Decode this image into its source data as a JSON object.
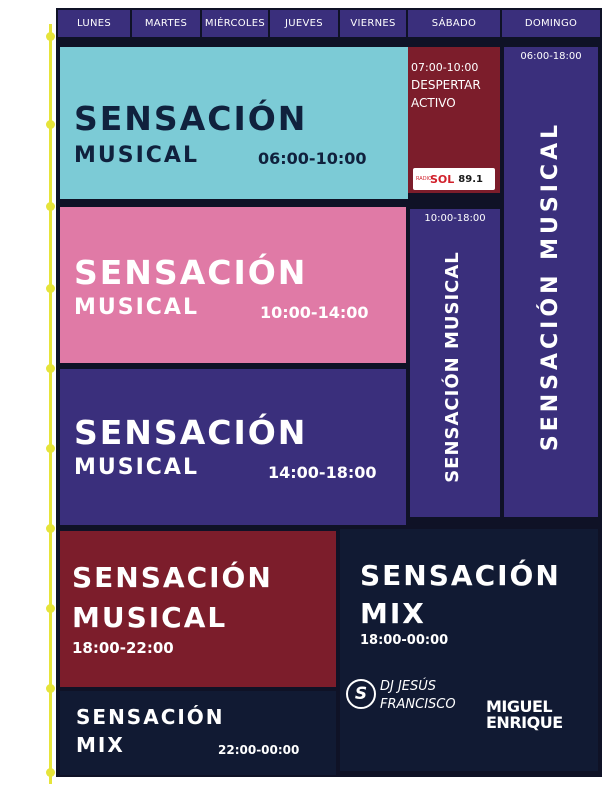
{
  "days": [
    "LUNES",
    "MARTES",
    "MIÉRCOLES",
    "JUEVES",
    "VIERNES",
    "SÁBADO",
    "DOMINGO"
  ],
  "blocks": {
    "b1": {
      "title1": "SENSACIÓN",
      "title2": "MUSICAL",
      "time": "06:00-10:00",
      "color": "#7ccbd6"
    },
    "b2": {
      "title1": "SENSACIÓN",
      "title2": "MUSICAL",
      "time": "10:00-14:00",
      "color": "#e07aa6"
    },
    "b3": {
      "title1": "SENSACIÓN",
      "title2": "MUSICAL",
      "time": "14:00-18:00",
      "color": "#3a2f7c"
    },
    "b4": {
      "title1": "SENSACIÓN",
      "title2": "MUSICAL",
      "time": "18:00-22:00",
      "color": "#7c1d2b"
    },
    "b5": {
      "title1": "SENSACIÓN",
      "title2": "MIX",
      "time": "22:00-00:00",
      "color": "#111a33"
    },
    "b6": {
      "title1": "SENSACIÓN",
      "title2": "MIX",
      "time": "18:00-00:00",
      "color": "#111a33"
    },
    "despertar": {
      "time": "07:00-10:00",
      "line1": "DESPERTAR",
      "line2": "ACTIVO",
      "color": "#7c1d2b"
    },
    "sat": {
      "time": "10:00-18:00",
      "label": "SENSACIÓN MUSICAL",
      "color": "#3a2f7c"
    },
    "sun": {
      "time": "06:00-18:00",
      "label": "SENSACIÓN MUSICAL",
      "color": "#3a2f7c"
    }
  },
  "logos": {
    "radio_small": "RADIO",
    "radio_name": "SOL",
    "radio_freq": "89.1",
    "dj_line1": "DJ JESÚS",
    "dj_line2": "FRANCISCO",
    "miguel_line1": "MIGUEL",
    "miguel_line2": "ENRIQUE"
  }
}
